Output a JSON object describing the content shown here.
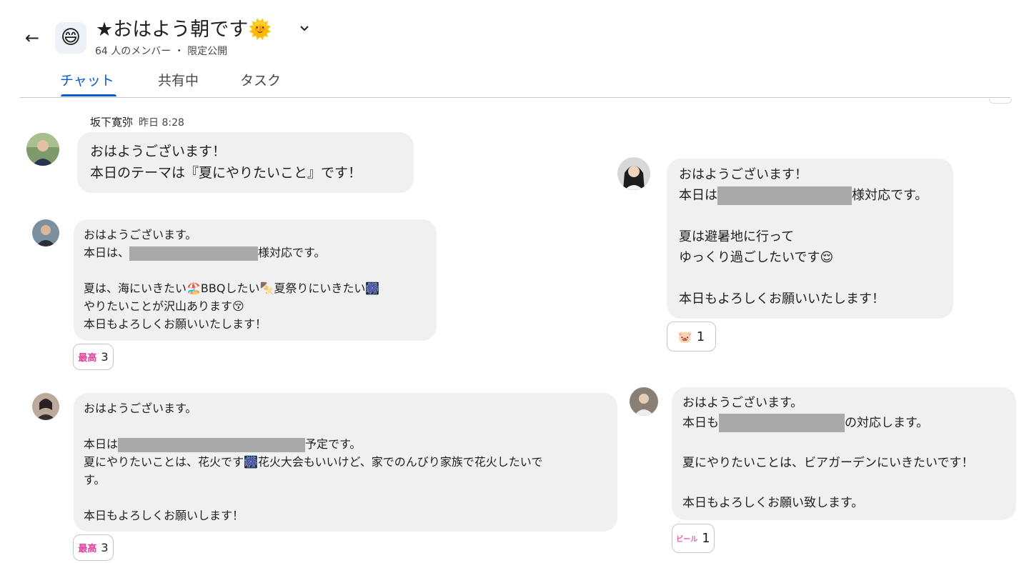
{
  "header": {
    "back_icon": "←",
    "space_icon": "😄",
    "title": "★おはよう朝です🌞",
    "dropdown_icon": "⌄",
    "subtitle": "64 人のメンバー ・ 限定公開",
    "tabs": [
      {
        "label": "チャット",
        "active": true
      },
      {
        "label": "共有中",
        "active": false
      },
      {
        "label": "タスク",
        "active": false
      }
    ]
  },
  "colors": {
    "accent": "#0b57d0",
    "bubble": "#f0f0f0",
    "redaction": "#a9a9a9"
  },
  "messages": [
    {
      "sender": "坂下寛弥",
      "time": "昨日 8:28",
      "lines": [
        "おはようございます！",
        "本日のテーマは『夏にやりたいこと』です！"
      ]
    },
    {
      "lines_a": [
        "おはようございます。",
        "本日は、"
      ],
      "line_b_suffix": "様対応です。",
      "lines_c": [
        "夏は、海にいきたい🏖️BBQしたい🍢夏祭りにいきたい🎆",
        "やりたいことが沢山あります😚",
        "本日もよろしくお願いいたします！"
      ],
      "reaction": {
        "icon": "最高",
        "count": "3"
      }
    },
    {
      "line1": "おはようございます。",
      "line2_prefix": "本日は",
      "line2_suffix": "予定です。",
      "lines_rest": [
        "夏にやりたいことは、花火です🎆花火大会もいいけど、家でのんびり家族で花火したいで",
        "す。"
      ],
      "closing": "本日もよろしくお願いします！",
      "reaction": {
        "icon": "最高",
        "count": "3"
      }
    },
    {
      "line1": "おはようございます！",
      "line2_prefix": "本日は",
      "line2_suffix": "様対応です。",
      "lines_rest": [
        "夏は避暑地に行って",
        "ゆっくり過ごしたいです😌"
      ],
      "closing": "本日もよろしくお願いいたします！",
      "reaction": {
        "icon": "🐷",
        "count": "1"
      }
    },
    {
      "line1": "おはようございます。",
      "line2_prefix": "本日も",
      "line2_suffix": "の対応します。",
      "lines_rest": [
        "夏にやりたいことは、ビアガーデンにいきたいです！"
      ],
      "closing": "本日もよろしくお願い致します。",
      "reaction": {
        "icon": "ビール",
        "count": "1"
      }
    }
  ]
}
